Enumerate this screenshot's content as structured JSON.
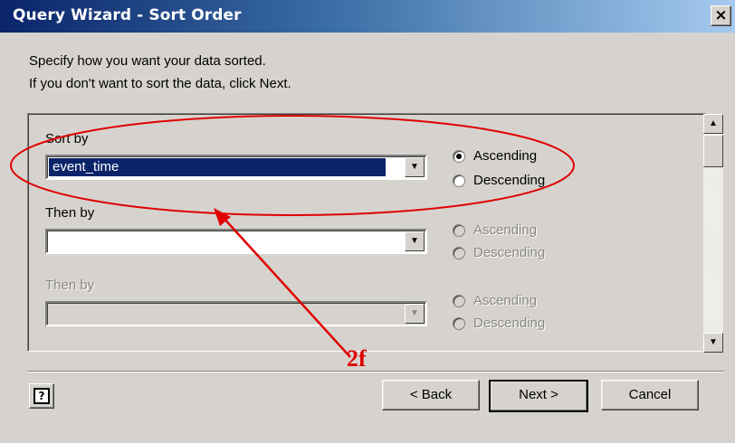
{
  "window": {
    "title": "Query Wizard - Sort Order",
    "close_glyph": "×"
  },
  "instructions": {
    "line1": "Specify how you want your data sorted.",
    "line2": "If you don't want to sort the data, click Next."
  },
  "sort_rows": [
    {
      "label": "Sort by",
      "value": "event_time",
      "enabled": true,
      "ascending_label": "Ascending",
      "descending_label": "Descending",
      "selected": "ascending"
    },
    {
      "label": "Then by",
      "value": "",
      "enabled": true,
      "ascending_label": "Ascending",
      "descending_label": "Descending",
      "selected": null
    },
    {
      "label": "Then by",
      "value": "",
      "enabled": false,
      "ascending_label": "Ascending",
      "descending_label": "Descending",
      "selected": null
    }
  ],
  "buttons": {
    "back": "< Back",
    "next": "Next >",
    "cancel": "Cancel",
    "help_glyph": "?"
  },
  "annotation": {
    "label": "2f",
    "color": "#e00000"
  },
  "colors": {
    "title_bar_start": "#0a246a",
    "title_bar_end": "#a6caf0",
    "dialog_face": "#d6d3ce",
    "selection": "#0a246a"
  }
}
